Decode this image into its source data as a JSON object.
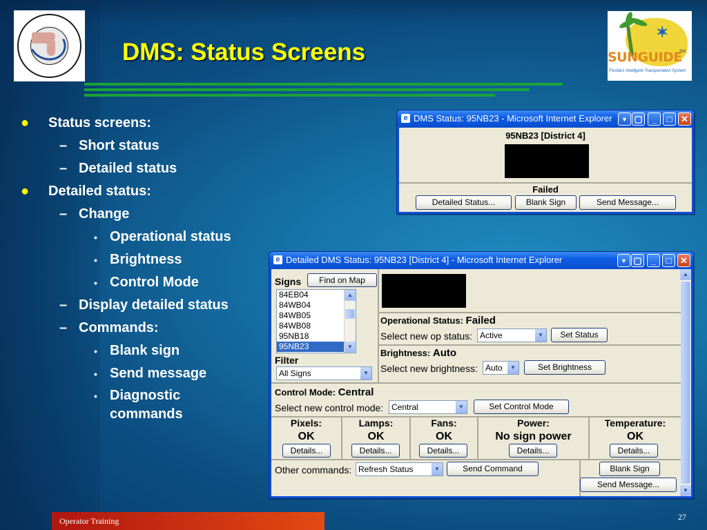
{
  "title": "DMS: Status Screens",
  "logos": {
    "fdot": {
      "ring_text": "STATE OF FLORIDA DEPARTMENT OF TRANSPORTATION"
    },
    "sunguide": {
      "word": "SUNGUIDE",
      "mark": "SM",
      "tagline": "Florida's Intelligent Transportation System"
    }
  },
  "bullets": {
    "status_screens": "Status screens:",
    "short_status": "Short status",
    "detailed_status_item": "Detailed status",
    "detailed_status": "Detailed status:",
    "change": "Change",
    "operational_status": "Operational status",
    "brightness": "Brightness",
    "control_mode": "Control Mode",
    "display_detailed": "Display detailed status",
    "commands": "Commands:",
    "blank_sign": "Blank sign",
    "send_message": "Send message",
    "diagnostic": "Diagnostic commands"
  },
  "glyphs": {
    "dot": "●",
    "dash": "–",
    "small_dot": "•"
  },
  "short_window": {
    "title": "DMS Status: 95NB23 - Microsoft Internet Explorer",
    "sign_header": "95NB23 [District 4]",
    "status": "Failed",
    "buttons": {
      "detailed": "Detailed Status...",
      "blank": "Blank Sign",
      "send": "Send Message..."
    }
  },
  "detail_window": {
    "title": "Detailed DMS Status: 95NB23 [District 4] - Microsoft Internet Explorer",
    "signs_label": "Signs",
    "find_on_map": "Find on Map",
    "signs": [
      "84EB04",
      "84WB04",
      "84WB05",
      "84WB08",
      "95NB18",
      "95NB23"
    ],
    "selected_sign": "95NB23",
    "filter_label": "Filter",
    "filter_value": "All Signs",
    "op_status_label": "Operational Status:",
    "op_status_value": "Failed",
    "op_select_label": "Select new op status:",
    "op_select_value": "Active",
    "set_status": "Set Status",
    "brightness_label": "Brightness:",
    "brightness_value": "Auto",
    "brightness_select_label": "Select new brightness:",
    "brightness_select_value": "Auto",
    "set_brightness": "Set Brightness",
    "control_mode_label": "Control Mode:",
    "control_mode_value": "Central",
    "control_select_label": "Select new control mode:",
    "control_select_value": "Central",
    "set_control_mode": "Set Control Mode",
    "diagnostics": [
      {
        "label": "Pixels:",
        "value": "OK",
        "button": "Details..."
      },
      {
        "label": "Lamps:",
        "value": "OK",
        "button": "Details..."
      },
      {
        "label": "Fans:",
        "value": "OK",
        "button": "Details..."
      },
      {
        "label": "Power:",
        "value": "No sign power",
        "button": "Details..."
      },
      {
        "label": "Temperature:",
        "value": "OK",
        "button": "Details..."
      }
    ],
    "other_commands_label": "Other commands:",
    "other_commands_value": "Refresh Status",
    "send_command": "Send Command",
    "blank_sign": "Blank Sign",
    "send_message": "Send Message..."
  },
  "footer": {
    "text": "Operator Training",
    "page": "27"
  }
}
